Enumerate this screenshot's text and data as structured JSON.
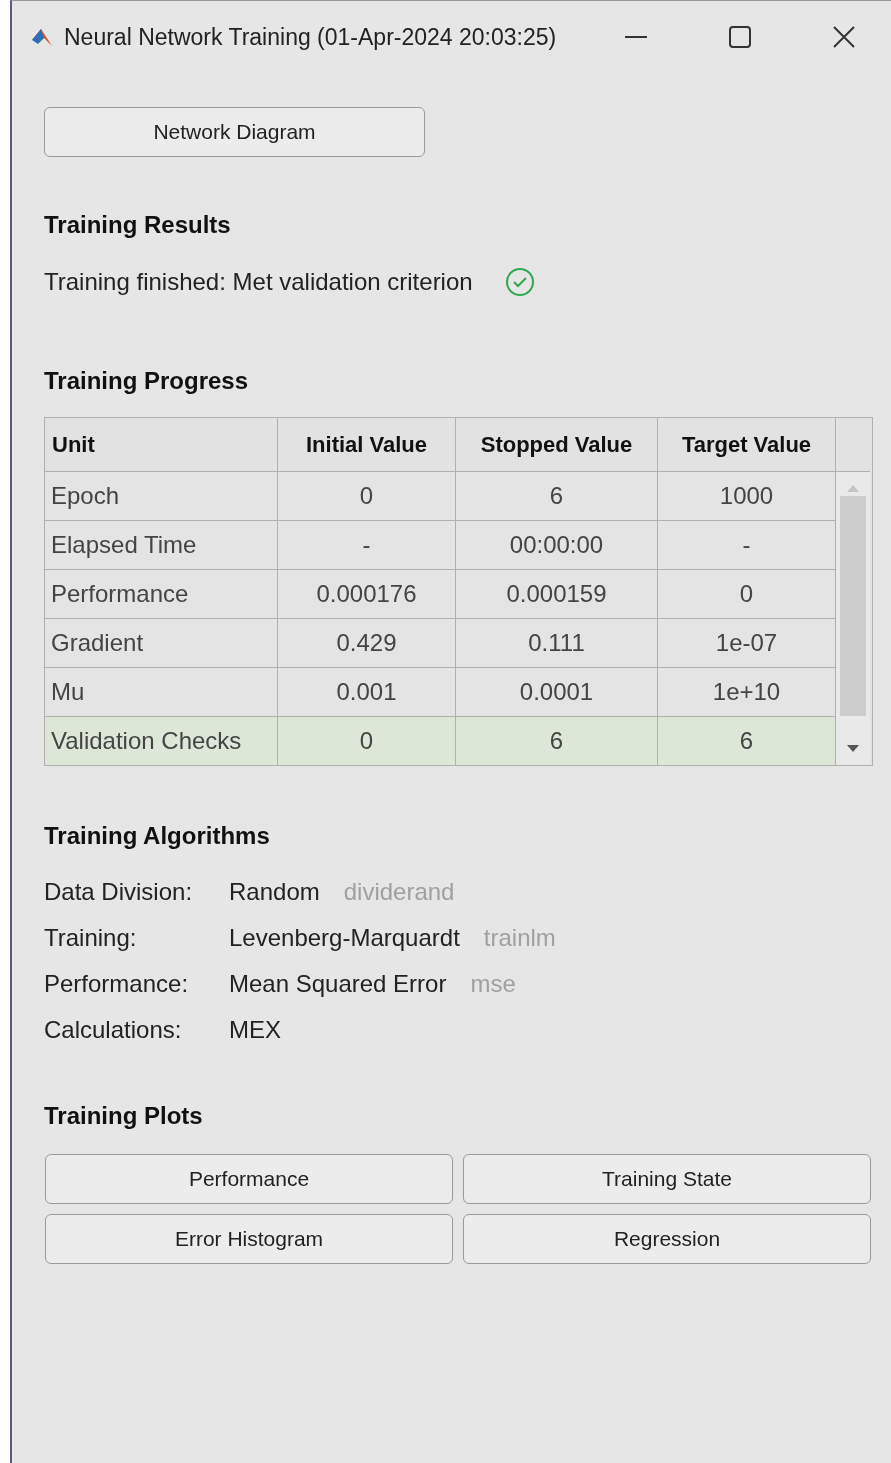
{
  "window": {
    "title": "Neural Network Training (01-Apr-2024 20:03:25)"
  },
  "diagram_button": "Network Diagram",
  "results": {
    "heading": "Training Results",
    "message": "Training finished: Met validation criterion",
    "success": true
  },
  "progress": {
    "heading": "Training Progress",
    "columns": [
      "Unit",
      "Initial Value",
      "Stopped Value",
      "Target Value"
    ],
    "rows": [
      {
        "cells": [
          "Epoch",
          "0",
          "6",
          "1000"
        ],
        "highlighted": false
      },
      {
        "cells": [
          "Elapsed Time",
          "-",
          "00:00:00",
          "-"
        ],
        "highlighted": false
      },
      {
        "cells": [
          "Performance",
          "0.000176",
          "0.000159",
          "0"
        ],
        "highlighted": false
      },
      {
        "cells": [
          "Gradient",
          "0.429",
          "0.111",
          "1e-07"
        ],
        "highlighted": false
      },
      {
        "cells": [
          "Mu",
          "0.001",
          "0.0001",
          "1e+10"
        ],
        "highlighted": false
      },
      {
        "cells": [
          "Validation Checks",
          "0",
          "6",
          "6"
        ],
        "highlighted": true
      }
    ]
  },
  "algorithms": {
    "heading": "Training Algorithms",
    "rows": [
      {
        "label": "Data Division:",
        "value": "Random",
        "function": "dividerand"
      },
      {
        "label": "Training:",
        "value": "Levenberg-Marquardt",
        "function": "trainlm"
      },
      {
        "label": "Performance:",
        "value": "Mean Squared Error",
        "function": "mse"
      },
      {
        "label": "Calculations:",
        "value": "MEX"
      }
    ]
  },
  "plots": {
    "heading": "Training Plots",
    "buttons": [
      "Performance",
      "Training State",
      "Error Histogram",
      "Regression"
    ]
  }
}
